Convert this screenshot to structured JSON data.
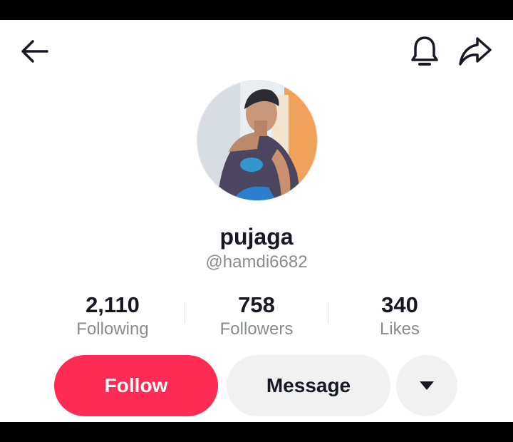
{
  "profile": {
    "display_name": "pujaga",
    "username": "@hamdi6682"
  },
  "stats": [
    {
      "value": "2,110",
      "label": "Following"
    },
    {
      "value": "758",
      "label": "Followers"
    },
    {
      "value": "340",
      "label": "Likes"
    }
  ],
  "actions": {
    "follow_label": "Follow",
    "message_label": "Message"
  },
  "icons": {
    "back": "arrow-left-icon",
    "notifications": "bell-icon",
    "share": "share-arrow-icon",
    "more": "caret-down-icon"
  },
  "colors": {
    "accent": "#fe2c55",
    "secondary_button": "#f1f1f2",
    "text_primary": "#161823",
    "text_secondary": "#8a8b91"
  }
}
